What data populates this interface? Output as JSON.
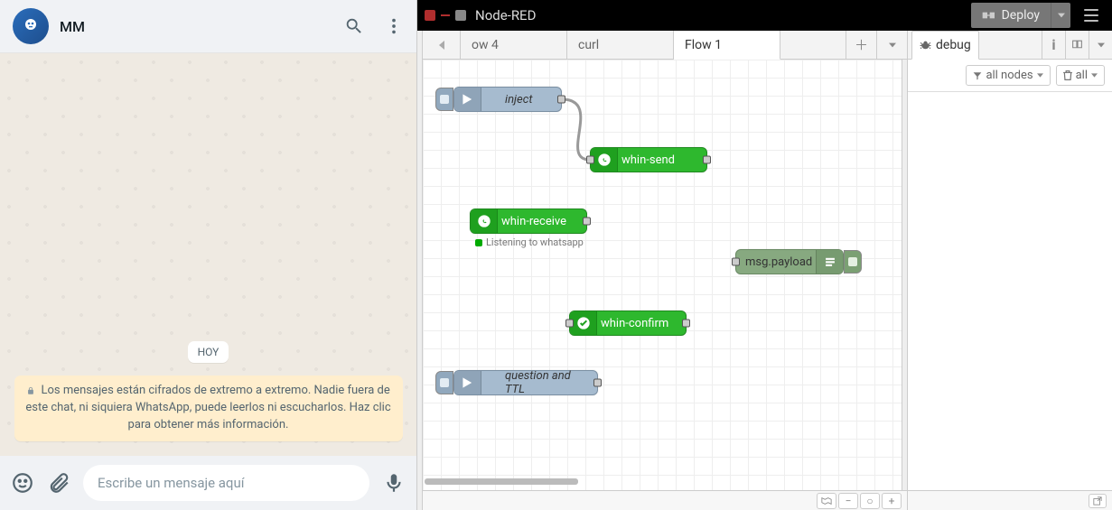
{
  "whatsapp": {
    "contact_name": "MM",
    "date_pill": "HOY",
    "encryption_notice": "Los mensajes están cifrados de extremo a extremo. Nadie fuera de este chat, ni siquiera WhatsApp, puede leerlos ni escucharlos. Haz clic para obtener más información.",
    "input_placeholder": "Escribe un mensaje aquí"
  },
  "nodered": {
    "title": "Node-RED",
    "deploy_label": "Deploy",
    "tabs": [
      "ow 4",
      "curl",
      "Flow 1"
    ],
    "active_tab": "Flow 1",
    "nodes": {
      "inject": "inject",
      "whin_send": "whin-send",
      "whin_receive": "whin-receive",
      "whin_receive_status": "Listening to whatsapp",
      "whin_confirm": "whin-confirm",
      "debug": "msg.payload",
      "inject2": "question and TTL"
    },
    "sidebar": {
      "tab_label": "debug",
      "filter_label": "all nodes",
      "clear_label": "all"
    }
  }
}
